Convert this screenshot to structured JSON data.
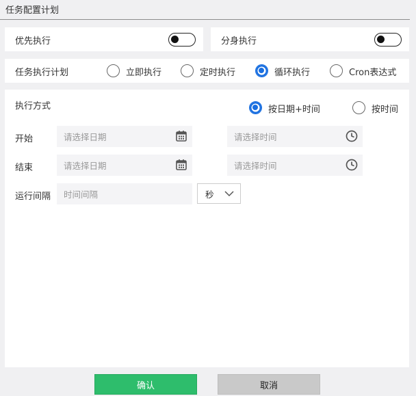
{
  "header": {
    "title": "任务配置计划"
  },
  "options": {
    "priority": {
      "label": "优先执行",
      "enabled": false
    },
    "split": {
      "label": "分身执行",
      "enabled": false
    }
  },
  "plan": {
    "label": "任务执行计划",
    "choices": [
      {
        "label": "立即执行",
        "selected": false
      },
      {
        "label": "定时执行",
        "selected": false
      },
      {
        "label": "循环执行",
        "selected": true
      },
      {
        "label": "Cron表达式",
        "selected": false
      }
    ]
  },
  "mode": {
    "label": "执行方式",
    "choices": [
      {
        "label": "按日期+时间",
        "selected": true
      },
      {
        "label": "按时间",
        "selected": false
      }
    ]
  },
  "start": {
    "label": "开始",
    "date_placeholder": "请选择日期",
    "time_placeholder": "请选择时间"
  },
  "end": {
    "label": "结束",
    "date_placeholder": "请选择日期",
    "time_placeholder": "请选择时间"
  },
  "interval": {
    "label": "运行间隔",
    "placeholder": "时间间隔",
    "unit": "秒"
  },
  "footer": {
    "confirm_label": "确认",
    "cancel_label": "取消"
  },
  "colors": {
    "accent": "#1a6fe0",
    "confirm": "#2ebd6c",
    "cancel": "#c9c9c9"
  },
  "icons": {
    "calendar": "calendar-icon",
    "clock": "clock-icon",
    "dropdown": "chevron-down-icon"
  }
}
